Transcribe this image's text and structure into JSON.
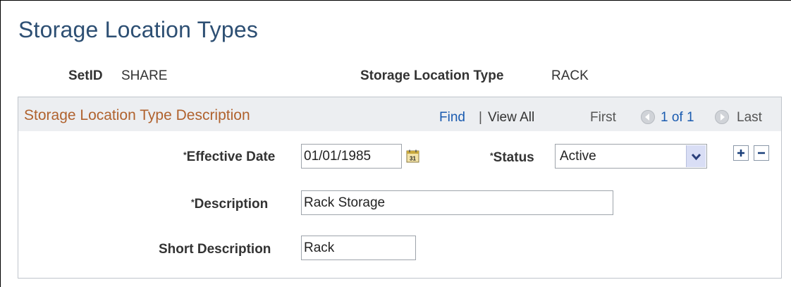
{
  "page": {
    "title": "Storage Location Types"
  },
  "keys": {
    "setid_label": "SetID",
    "setid_value": "SHARE",
    "sl_type_label": "Storage Location Type",
    "sl_type_value": "RACK"
  },
  "grid": {
    "title": "Storage Location Type Description",
    "find": "Find",
    "separator": "|",
    "view_all": "View All",
    "first": "First",
    "range": "1 of 1",
    "last": "Last",
    "prev_icon": "prev-arrow-icon",
    "next_icon": "next-arrow-icon"
  },
  "form": {
    "required_marker": "*",
    "effective_date_label": "Effective Date",
    "effective_date_value": "01/01/1985",
    "calendar_icon": "calendar-icon",
    "status_label": "Status",
    "status_value": "Active",
    "description_label": "Description",
    "description_value": "Rack Storage",
    "short_description_label": "Short Description",
    "short_description_value": "Rack",
    "add_row_icon": "plus-icon",
    "delete_row_icon": "minus-icon"
  },
  "colors": {
    "title": "#2d4f73",
    "grid_title": "#b0622e",
    "link": "#1a5bb0",
    "grid_header_bg": "#eceef1"
  }
}
